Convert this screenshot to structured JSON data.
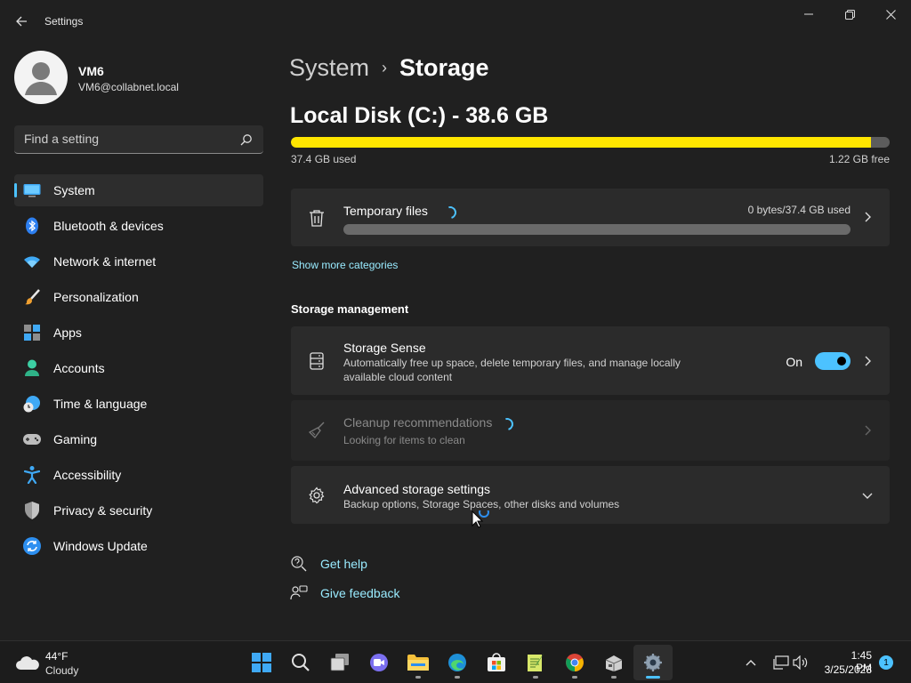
{
  "window": {
    "title": "Settings",
    "back_icon": "back-arrow-icon",
    "minimize_icon": "minimize-icon",
    "restore_icon": "restore-icon",
    "close_icon": "close-icon"
  },
  "profile": {
    "name": "VM6",
    "email": "VM6@collabnet.local"
  },
  "search": {
    "placeholder": "Find a setting"
  },
  "sidebar": {
    "items": [
      {
        "label": "System",
        "icon": "system-icon",
        "active": true
      },
      {
        "label": "Bluetooth & devices",
        "icon": "bluetooth-icon"
      },
      {
        "label": "Network & internet",
        "icon": "wifi-icon"
      },
      {
        "label": "Personalization",
        "icon": "brush-icon"
      },
      {
        "label": "Apps",
        "icon": "apps-icon"
      },
      {
        "label": "Accounts",
        "icon": "accounts-icon"
      },
      {
        "label": "Time & language",
        "icon": "time-language-icon"
      },
      {
        "label": "Gaming",
        "icon": "gamepad-icon"
      },
      {
        "label": "Accessibility",
        "icon": "accessibility-icon"
      },
      {
        "label": "Privacy & security",
        "icon": "shield-icon"
      },
      {
        "label": "Windows Update",
        "icon": "windows-update-icon"
      }
    ]
  },
  "breadcrumb": {
    "parent": "System",
    "separator": "›",
    "current": "Storage"
  },
  "disk": {
    "title": "Local Disk (C:) - 38.6 GB",
    "used_label": "37.4 GB used",
    "free_label": "1.22 GB free",
    "used_fraction": 0.969,
    "bar_color": "#ffe600"
  },
  "temp_files": {
    "title": "Temporary files",
    "usage": "0 bytes/37.4 GB used",
    "icon": "trash-icon"
  },
  "show_more": "Show more categories",
  "storage_management": {
    "header": "Storage management",
    "storage_sense": {
      "title": "Storage Sense",
      "description": "Automatically free up space, delete temporary files, and manage locally available cloud content",
      "toggle_label": "On",
      "toggle_on": true,
      "icon": "storage-sense-icon"
    },
    "cleanup": {
      "title": "Cleanup recommendations",
      "description": "Looking for items to clean",
      "icon": "broom-icon",
      "disabled": true
    },
    "advanced": {
      "title": "Advanced storage settings",
      "description": "Backup options, Storage Spaces, other disks and volumes",
      "icon": "gear-icon"
    }
  },
  "footer": {
    "get_help": "Get help",
    "give_feedback": "Give feedback"
  },
  "taskbar": {
    "weather_temp": "44°F",
    "weather_condition": "Cloudy",
    "apps": [
      {
        "name": "start",
        "icon": "windows-start-icon"
      },
      {
        "name": "search",
        "icon": "search-icon"
      },
      {
        "name": "task-view",
        "icon": "task-view-icon"
      },
      {
        "name": "chat",
        "icon": "chat-icon"
      },
      {
        "name": "file-explorer",
        "icon": "folder-icon",
        "running": true
      },
      {
        "name": "edge",
        "icon": "edge-icon",
        "running": true
      },
      {
        "name": "store",
        "icon": "store-icon"
      },
      {
        "name": "notepad",
        "icon": "notepad-icon",
        "running": true
      },
      {
        "name": "chrome",
        "icon": "chrome-icon",
        "running": true
      },
      {
        "name": "app",
        "icon": "app-icon",
        "running": true
      },
      {
        "name": "settings",
        "icon": "settings-gear-icon",
        "active": true
      }
    ],
    "time": "1:45 PM",
    "date": "3/25/2023",
    "notification_count": "1"
  },
  "colors": {
    "accent": "#4cc2ff",
    "background": "#202020",
    "card": "#2b2b2b",
    "link": "#99ebff"
  }
}
